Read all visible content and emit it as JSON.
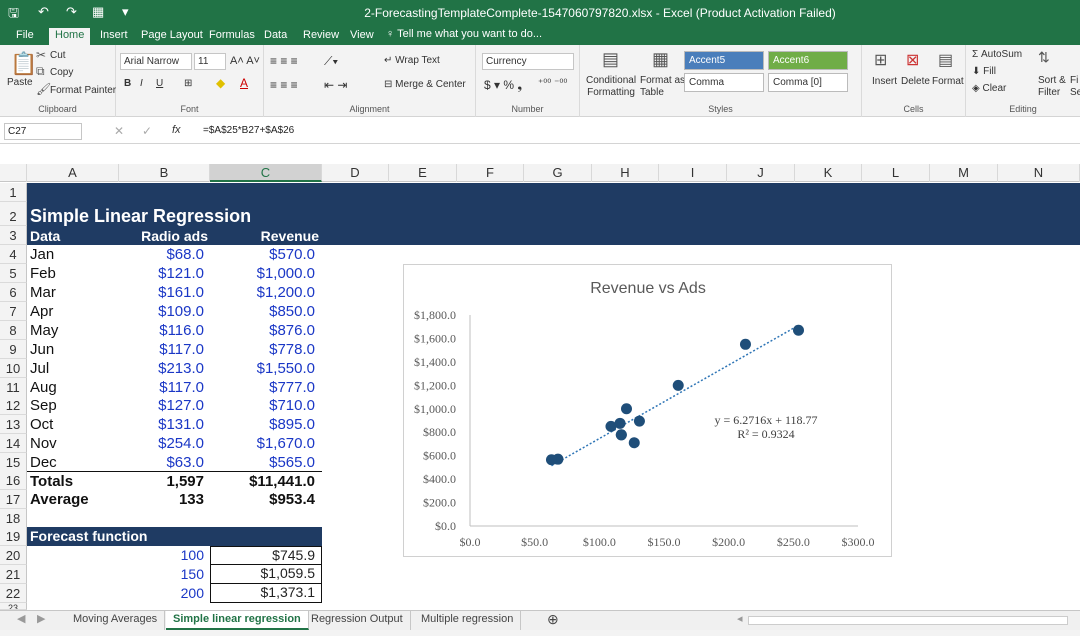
{
  "window": {
    "title": "2-ForecastingTemplateComplete-1547060797820.xlsx - Excel (Product Activation Failed)"
  },
  "ribbon_tabs": [
    "File",
    "Home",
    "Insert",
    "Page Layout",
    "Formulas",
    "Data",
    "Review",
    "View"
  ],
  "tell_me": "Tell me what you want to do...",
  "ribbon": {
    "clipboard": {
      "paste": "Paste",
      "cut": "Cut",
      "copy": "Copy",
      "format_painter": "Format Painter",
      "label": "Clipboard"
    },
    "font": {
      "name": "Arial Narrow",
      "size": "11",
      "label": "Font"
    },
    "alignment": {
      "wrap": "Wrap Text",
      "merge": "Merge & Center",
      "label": "Alignment"
    },
    "number": {
      "format": "Currency",
      "label": "Number"
    },
    "styles": {
      "conditional": "Conditional\nFormatting",
      "format_as": "Format as\nTable",
      "accent5": "Accent5",
      "accent6": "Accent6",
      "comma": "Comma",
      "comma0": "Comma [0]",
      "label": "Styles"
    },
    "cells": {
      "insert": "Insert",
      "delete": "Delete",
      "format": "Format",
      "label": "Cells"
    },
    "editing": {
      "autosum": "AutoSum",
      "fill": "Fill",
      "clear": "Clear",
      "sort": "Sort &\nFilter",
      "find": "Fi\nSe",
      "label": "Editing"
    }
  },
  "formula_bar": {
    "name_box": "C27",
    "fx": "fx",
    "formula": "=$A$25*B27+$A$26"
  },
  "columns": [
    "A",
    "B",
    "C",
    "D",
    "E",
    "F",
    "G",
    "H",
    "I",
    "J",
    "K",
    "L",
    "M",
    "N"
  ],
  "rows": [
    "1",
    "2",
    "3",
    "4",
    "5",
    "6",
    "7",
    "8",
    "9",
    "10",
    "11",
    "12",
    "13",
    "14",
    "15",
    "16",
    "17",
    "18",
    "19",
    "20",
    "21",
    "22",
    "23"
  ],
  "sheet": {
    "title": "Simple Linear Regression",
    "headers": {
      "data": "Data",
      "ads": "Radio ads",
      "revenue": "Revenue"
    },
    "months": [
      {
        "month": "Jan",
        "ads": "$68.0",
        "revenue": "$570.0"
      },
      {
        "month": "Feb",
        "ads": "$121.0",
        "revenue": "$1,000.0"
      },
      {
        "month": "Mar",
        "ads": "$161.0",
        "revenue": "$1,200.0"
      },
      {
        "month": "Apr",
        "ads": "$109.0",
        "revenue": "$850.0"
      },
      {
        "month": "May",
        "ads": "$116.0",
        "revenue": "$876.0"
      },
      {
        "month": "Jun",
        "ads": "$117.0",
        "revenue": "$778.0"
      },
      {
        "month": "Jul",
        "ads": "$213.0",
        "revenue": "$1,550.0"
      },
      {
        "month": "Aug",
        "ads": "$117.0",
        "revenue": "$777.0"
      },
      {
        "month": "Sep",
        "ads": "$127.0",
        "revenue": "$710.0"
      },
      {
        "month": "Oct",
        "ads": "$131.0",
        "revenue": "$895.0"
      },
      {
        "month": "Nov",
        "ads": "$254.0",
        "revenue": "$1,670.0"
      },
      {
        "month": "Dec",
        "ads": "$63.0",
        "revenue": "$565.0"
      }
    ],
    "totals": {
      "label": "Totals",
      "ads": "1,597",
      "revenue": "$11,441.0"
    },
    "average": {
      "label": "Average",
      "ads": "133",
      "revenue": "$953.4"
    },
    "forecast": {
      "label": "Forecast function",
      "rows": [
        {
          "input": "100",
          "output": "$745.9"
        },
        {
          "input": "150",
          "output": "$1,059.5"
        },
        {
          "input": "200",
          "output": "$1,373.1"
        }
      ]
    }
  },
  "chart_data": {
    "type": "scatter",
    "title": "Revenue vs Ads",
    "xlabel": "",
    "ylabel": "",
    "xlim": [
      0,
      300
    ],
    "ylim": [
      0,
      1800
    ],
    "xticks": [
      "$0.0",
      "$50.0",
      "$100.0",
      "$150.0",
      "$200.0",
      "$250.0",
      "$300.0"
    ],
    "yticks": [
      "$0.0",
      "$200.0",
      "$400.0",
      "$600.0",
      "$800.0",
      "$1,000.0",
      "$1,200.0",
      "$1,400.0",
      "$1,600.0",
      "$1,800.0"
    ],
    "series": [
      {
        "x": [
          68,
          121,
          161,
          109,
          116,
          117,
          213,
          117,
          127,
          131,
          254,
          63
        ],
        "y": [
          570,
          1000,
          1200,
          850,
          876,
          778,
          1550,
          777,
          710,
          895,
          1670,
          565
        ]
      }
    ],
    "trendline": {
      "slope": 6.2716,
      "intercept": 118.77
    },
    "equation": "y = 6.2716x + 118.77",
    "r_squared": "R² = 0.9324",
    "colors": {
      "points": "#1f4e79",
      "trend": "#2e75b6"
    }
  },
  "sheet_tabs": [
    "Moving Averages",
    "Simple linear regression",
    "Regression Output",
    "Multiple regression"
  ],
  "active_sheet": "Simple linear regression",
  "colors": {
    "excel_green": "#217346",
    "band": "#1f3b63",
    "number_blue": "#1a37c6"
  }
}
